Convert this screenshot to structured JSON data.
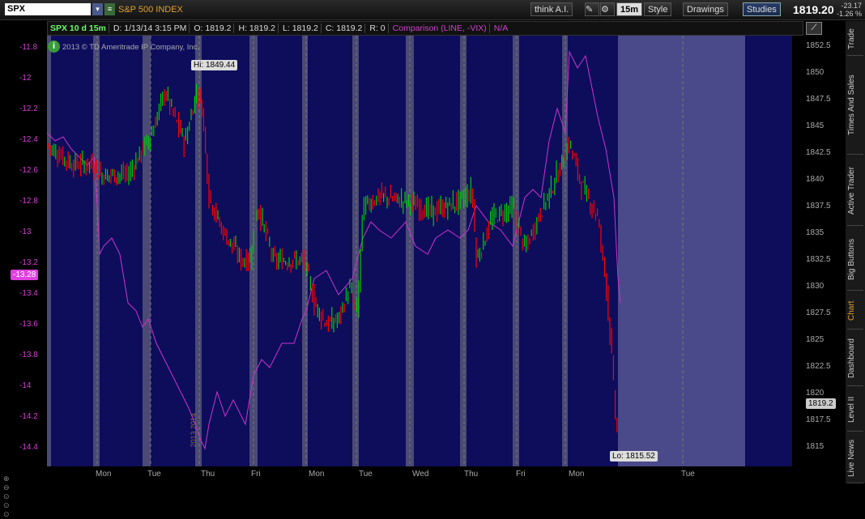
{
  "toolbar": {
    "symbol": "SPX",
    "description": "S&P 500 INDEX",
    "think_ai": "think A.I.",
    "period": "15m",
    "style": "Style",
    "drawings": "Drawings",
    "studies": "Studies",
    "last_price": "1819.20",
    "change": "-23.17",
    "change_pct": "-1.26 %"
  },
  "infobar": {
    "title": "SPX 10 d 15m",
    "date": "D: 1/13/14 3:15 PM",
    "open": "O: 1819.2",
    "high": "H: 1819.2",
    "low": "L: 1819.2",
    "close": "C: 1819.2",
    "r": "R: 0",
    "comparison": "Comparison (LINE, -VIX)",
    "na": "N/A"
  },
  "copyright": "2013 © TD Ameritrade IP Company, Inc.",
  "hi_label": "Hi: 1849.44",
  "lo_label": "Lo: 1815.52",
  "last_label": "1819.2",
  "vix_label": "-13.28",
  "year_marker": "2013 2014",
  "left_axis": [
    "-11.8",
    "-12",
    "-12.2",
    "-12.4",
    "-12.6",
    "-12.8",
    "-13",
    "-13.2",
    "-13.4",
    "-13.6",
    "-13.8",
    "-14",
    "-14.2",
    "-14.4"
  ],
  "right_axis": [
    "1852.5",
    "1850",
    "1847.5",
    "1845",
    "1842.5",
    "1840",
    "1837.5",
    "1835",
    "1832.5",
    "1830",
    "1827.5",
    "1825",
    "1822.5",
    "1820",
    "1817.5",
    "1815"
  ],
  "x_axis": [
    "Mon",
    "Tue",
    "Thu",
    "Fri",
    "Mon",
    "Tue",
    "Wed",
    "Thu",
    "Fri",
    "Mon",
    "Tue"
  ],
  "side_tabs": [
    "Trade",
    "Times And Sales",
    "Active Trader",
    "Big Buttons",
    "Chart",
    "Dashboard",
    "Level II",
    "Live News"
  ],
  "colors": {
    "up": "#00cc00",
    "down": "#ff0000",
    "vix": "#cc33cc",
    "bg": "#0d0d5c",
    "future": "#4a4a8a"
  }
}
